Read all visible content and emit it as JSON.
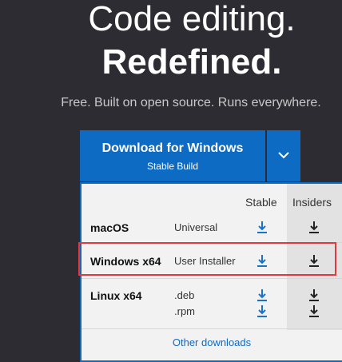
{
  "hero": {
    "line1": "Code editing.",
    "line2": "Redefined.",
    "subtitle": "Free. Built on open source. Runs everywhere."
  },
  "download_button": {
    "title": "Download for Windows",
    "subtitle": "Stable Build"
  },
  "dropdown_toggle_icon": "chevron-down-icon",
  "table": {
    "headers": {
      "stable": "Stable",
      "insiders": "Insiders"
    },
    "rows": [
      {
        "os": "macOS",
        "types": [
          "Universal"
        ]
      },
      {
        "os": "Windows x64",
        "types": [
          "User Installer"
        ]
      },
      {
        "os": "Linux x64",
        "types": [
          ".deb",
          ".rpm"
        ]
      }
    ]
  },
  "other_downloads": "Other downloads",
  "colors": {
    "accent": "#0e6bc4",
    "stable_icon": "#1a73c9",
    "insiders_icon": "#222222",
    "highlight": "#e0393e"
  }
}
